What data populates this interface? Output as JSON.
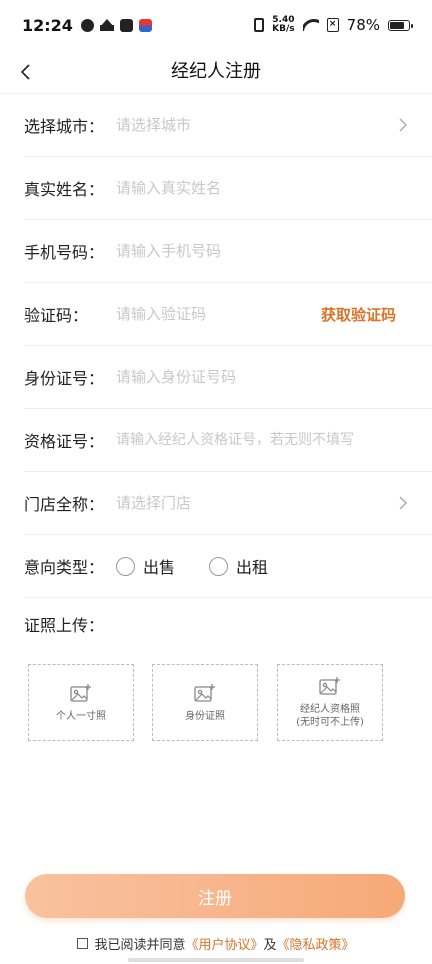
{
  "status_bar": {
    "time": "12:24",
    "speed_value": "5.40",
    "speed_unit": "KB/s",
    "battery_percent": "78%",
    "battery_level": 0.78
  },
  "nav": {
    "title": "经纪人注册"
  },
  "form": {
    "city": {
      "label": "选择城市：",
      "placeholder": "请选择城市"
    },
    "name": {
      "label": "真实姓名：",
      "placeholder": "请输入真实姓名"
    },
    "phone": {
      "label": "手机号码：",
      "placeholder": "请输入手机号码"
    },
    "code": {
      "label": "验证码：",
      "placeholder": "请输入验证码",
      "get_code": "获取验证码"
    },
    "id_number": {
      "label": "身份证号：",
      "placeholder": "请输入身份证号码"
    },
    "license": {
      "label": "资格证号：",
      "placeholder": "请输入经纪人资格证号，若无则不填写"
    },
    "store": {
      "label": "门店全称：",
      "placeholder": "请选择门店"
    },
    "intent": {
      "label": "意向类型：",
      "options": [
        "出售",
        "出租"
      ]
    }
  },
  "upload": {
    "title": "证照上传：",
    "items": [
      {
        "line1": "个人一寸照",
        "line2": ""
      },
      {
        "line1": "身份证照",
        "line2": ""
      },
      {
        "line1": "经纪人资格照",
        "line2": "(无时可不上传)"
      }
    ]
  },
  "register_label": "注册",
  "agreement": {
    "prefix": "我已阅读并同意",
    "user_agreement": "《用户协议》",
    "conjunction": "及",
    "privacy_policy": "《隐私政策》"
  },
  "colors": {
    "accent": "#d9742a",
    "button_start": "#f9c29f",
    "button_end": "#f6a978"
  }
}
